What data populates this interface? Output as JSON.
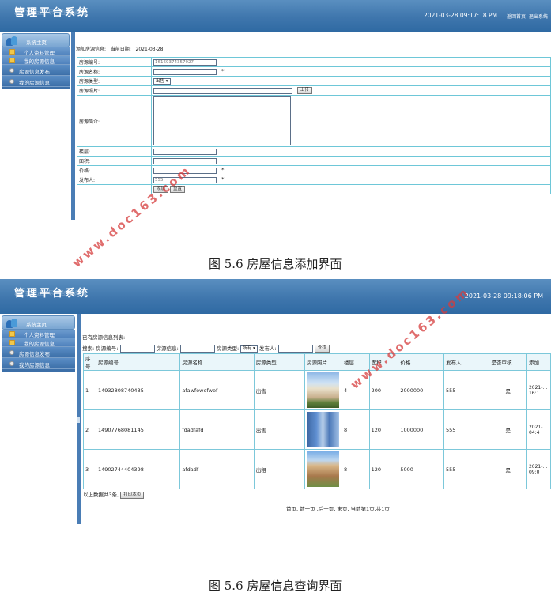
{
  "app": {
    "title": "管理平台系统",
    "title_reflection": "管理平台系统"
  },
  "screen1": {
    "datetime": "2021-03-28 09:17:18 PM",
    "links": [
      "返回首页",
      "退出系统"
    ]
  },
  "screen2": {
    "datetime": "2021-03-28 09:18:06 PM"
  },
  "sidebar": {
    "home": "系统主页",
    "items": [
      {
        "label": "个人资料管理",
        "type": "sub"
      },
      {
        "label": "我的房源信息",
        "type": "sub"
      },
      {
        "label": "房源信息发布",
        "type": "main"
      },
      {
        "label": "我的房源信息",
        "type": "main"
      }
    ]
  },
  "add_form": {
    "heading": "添加房源信息:",
    "date_label": "当前日期:",
    "date_value": "2021-03-28",
    "fields": {
      "code_label": "房源编号:",
      "code_value": "16169374357927",
      "name_label": "房源名称:",
      "type_label": "房源类型:",
      "type_value": "出售",
      "photo_label": "房源照片:",
      "upload_btn": "上传",
      "intro_label": "房源简介:",
      "floor_label": "楼层:",
      "area_label": "面积:",
      "price_label": "价格:",
      "publisher_label": "发布人:",
      "publisher_value": "555"
    },
    "required_mark": "*",
    "submit_btn": "添加",
    "reset_btn": "重置"
  },
  "list": {
    "heading": "已有房源信息列表:",
    "search": {
      "label": "搜索:",
      "code_label": "房源编号:",
      "info_label": "房源信息:",
      "type_label": "房源类型:",
      "type_value": "所有",
      "publisher_label": "发布人:",
      "button": "查找"
    },
    "columns": [
      "序号",
      "房源编号",
      "房源名称",
      "房源类型",
      "房源照片",
      "楼层",
      "面积",
      "价格",
      "发布人",
      "是否审核",
      "添加"
    ],
    "rows": [
      {
        "no": "1",
        "code": "14932808740435",
        "name": "afawfewefwef",
        "type": "出售",
        "floor": "4",
        "area": "200",
        "price": "2000000",
        "publisher": "555",
        "audited": "是",
        "added": "2021-…",
        "added_time": "16:1"
      },
      {
        "no": "2",
        "code": "14907768081145",
        "name": "fdadfafd",
        "type": "出售",
        "floor": "8",
        "area": "120",
        "price": "1000000",
        "publisher": "555",
        "audited": "是",
        "added": "2021-…",
        "added_time": "04:4"
      },
      {
        "no": "3",
        "code": "14902744404398",
        "name": "afdadf",
        "type": "出租",
        "floor": "8",
        "area": "120",
        "price": "5000",
        "publisher": "555",
        "audited": "是",
        "added": "2021-…",
        "added_time": "09:0"
      }
    ],
    "total_text": "以上数据共3条,",
    "print_btn": "打印本页",
    "pager": "首页, 前一页 ,后一页, 末页, 当前第1页,共1页"
  },
  "captions": {
    "fig1": "图 5.6 房屋信息添加界面",
    "fig2": "图 5.6 房屋信息查询界面"
  },
  "watermark": "www.doc163.com"
}
